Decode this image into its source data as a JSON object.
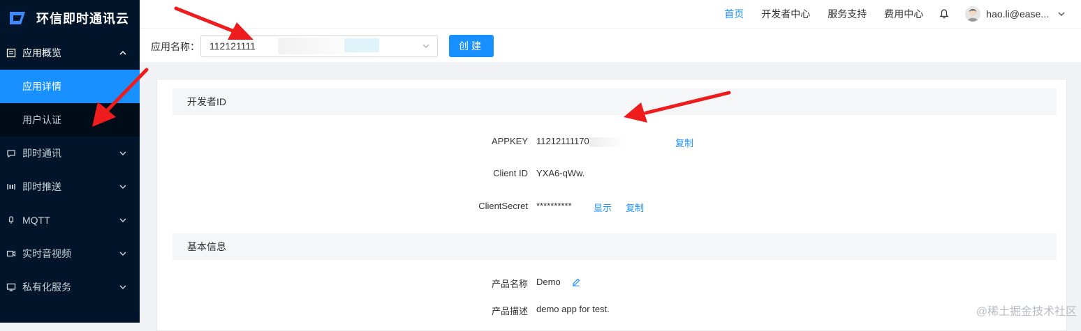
{
  "sidebar": {
    "brand": "环信即时通讯云",
    "menu": [
      {
        "label": "应用概览",
        "icon": "overview-icon",
        "open": true,
        "children": [
          {
            "label": "应用详情",
            "active": true
          },
          {
            "label": "用户认证",
            "active": false
          }
        ]
      },
      {
        "label": "即时通讯",
        "icon": "chat-icon"
      },
      {
        "label": "即时推送",
        "icon": "push-icon"
      },
      {
        "label": "MQTT",
        "icon": "mqtt-icon"
      },
      {
        "label": "实时音视频",
        "icon": "video-icon"
      },
      {
        "label": "私有化服务",
        "icon": "monitor-icon"
      }
    ]
  },
  "header": {
    "nav": [
      "首页",
      "开发者中心",
      "服务支持",
      "费用中心"
    ],
    "active_nav": "首页",
    "user_email": "hao.li@ease..."
  },
  "app_bar": {
    "label": "应用名称：",
    "selected_app": "112121111",
    "create_button": "创建"
  },
  "developer_id": {
    "title": "开发者ID",
    "appkey_label": "APPKEY",
    "appkey_value": "11212111170",
    "copy_label": "复制",
    "client_id_label": "Client ID",
    "client_id_value": "YXA6-qWw.",
    "client_secret_label": "ClientSecret",
    "client_secret_value": "**********",
    "show_label": "显示"
  },
  "basic_info": {
    "title": "基本信息",
    "product_name_label": "产品名称",
    "product_name_value": "Demo",
    "product_desc_label": "产品描述",
    "product_desc_value": "demo app for test."
  },
  "watermark": "@稀土掘金技术社区",
  "colors": {
    "sidebar_bg": "#001529",
    "accent": "#1890ff",
    "arrow": "#ee1c1c"
  }
}
